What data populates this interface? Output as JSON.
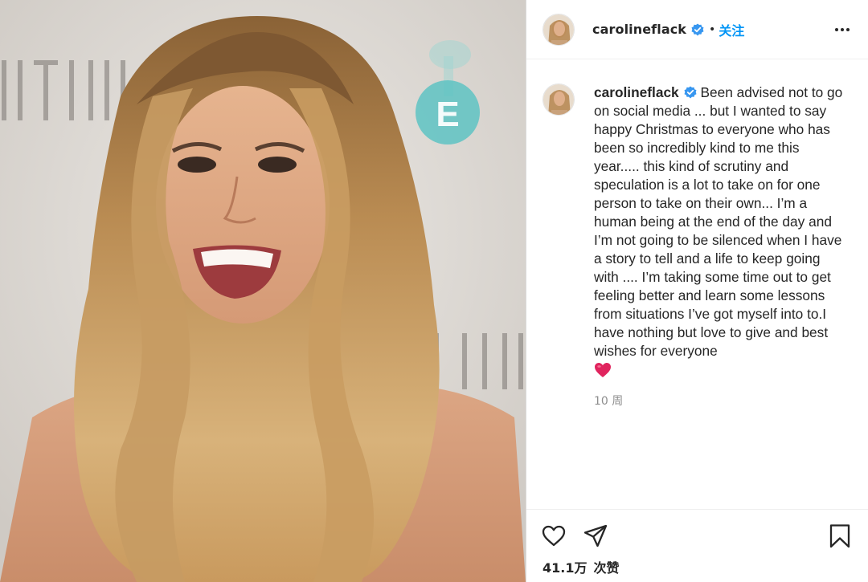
{
  "post": {
    "author": {
      "username": "carolineflack",
      "verified": true,
      "verified_icon": "verified-badge-icon",
      "avatar_icon": "profile-avatar"
    },
    "header": {
      "separator": "•",
      "follow_label": "关注",
      "more_icon": "more-options-icon"
    },
    "caption": {
      "text": "Been advised not to go on social media ... but I wanted to say happy Christmas to everyone who has been so incredibly kind to me this year..... this kind of scrutiny and speculation is a lot to take on for one person to take on their own... I’m a human being at the end of the day and I’m not going to be silenced when I have a story to tell and a life to keep going with .... I’m taking some time out to get feeling better and learn some lessons from situations I’ve got myself into to.I have nothing but love to give and best wishes for everyone",
      "emoji": "heart-emoji"
    },
    "timestamp": "10 周",
    "actions": {
      "like_icon": "heart-outline-icon",
      "share_icon": "paper-plane-icon",
      "save_icon": "bookmark-icon"
    },
    "likes": {
      "count": "41.1万",
      "label": "次赞"
    }
  },
  "colors": {
    "link_blue": "#0095f6",
    "text": "#262626",
    "muted": "#8e8e8e",
    "verified_blue": "#3897f0",
    "heart_red": "#e0245e"
  }
}
